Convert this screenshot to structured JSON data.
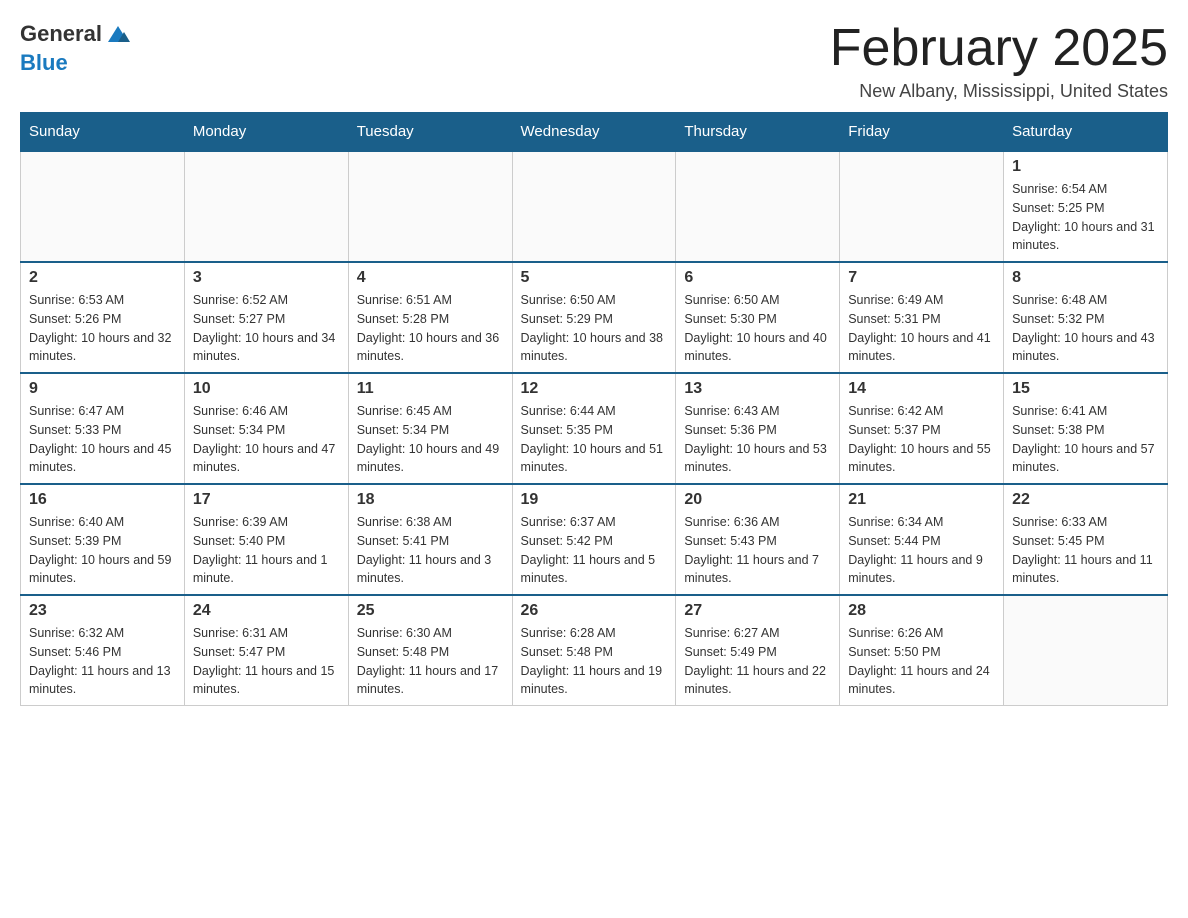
{
  "header": {
    "logo_general": "General",
    "logo_blue": "Blue",
    "month_title": "February 2025",
    "location": "New Albany, Mississippi, United States"
  },
  "weekdays": [
    "Sunday",
    "Monday",
    "Tuesday",
    "Wednesday",
    "Thursday",
    "Friday",
    "Saturday"
  ],
  "weeks": [
    [
      {
        "day": "",
        "info": ""
      },
      {
        "day": "",
        "info": ""
      },
      {
        "day": "",
        "info": ""
      },
      {
        "day": "",
        "info": ""
      },
      {
        "day": "",
        "info": ""
      },
      {
        "day": "",
        "info": ""
      },
      {
        "day": "1",
        "info": "Sunrise: 6:54 AM\nSunset: 5:25 PM\nDaylight: 10 hours and 31 minutes."
      }
    ],
    [
      {
        "day": "2",
        "info": "Sunrise: 6:53 AM\nSunset: 5:26 PM\nDaylight: 10 hours and 32 minutes."
      },
      {
        "day": "3",
        "info": "Sunrise: 6:52 AM\nSunset: 5:27 PM\nDaylight: 10 hours and 34 minutes."
      },
      {
        "day": "4",
        "info": "Sunrise: 6:51 AM\nSunset: 5:28 PM\nDaylight: 10 hours and 36 minutes."
      },
      {
        "day": "5",
        "info": "Sunrise: 6:50 AM\nSunset: 5:29 PM\nDaylight: 10 hours and 38 minutes."
      },
      {
        "day": "6",
        "info": "Sunrise: 6:50 AM\nSunset: 5:30 PM\nDaylight: 10 hours and 40 minutes."
      },
      {
        "day": "7",
        "info": "Sunrise: 6:49 AM\nSunset: 5:31 PM\nDaylight: 10 hours and 41 minutes."
      },
      {
        "day": "8",
        "info": "Sunrise: 6:48 AM\nSunset: 5:32 PM\nDaylight: 10 hours and 43 minutes."
      }
    ],
    [
      {
        "day": "9",
        "info": "Sunrise: 6:47 AM\nSunset: 5:33 PM\nDaylight: 10 hours and 45 minutes."
      },
      {
        "day": "10",
        "info": "Sunrise: 6:46 AM\nSunset: 5:34 PM\nDaylight: 10 hours and 47 minutes."
      },
      {
        "day": "11",
        "info": "Sunrise: 6:45 AM\nSunset: 5:34 PM\nDaylight: 10 hours and 49 minutes."
      },
      {
        "day": "12",
        "info": "Sunrise: 6:44 AM\nSunset: 5:35 PM\nDaylight: 10 hours and 51 minutes."
      },
      {
        "day": "13",
        "info": "Sunrise: 6:43 AM\nSunset: 5:36 PM\nDaylight: 10 hours and 53 minutes."
      },
      {
        "day": "14",
        "info": "Sunrise: 6:42 AM\nSunset: 5:37 PM\nDaylight: 10 hours and 55 minutes."
      },
      {
        "day": "15",
        "info": "Sunrise: 6:41 AM\nSunset: 5:38 PM\nDaylight: 10 hours and 57 minutes."
      }
    ],
    [
      {
        "day": "16",
        "info": "Sunrise: 6:40 AM\nSunset: 5:39 PM\nDaylight: 10 hours and 59 minutes."
      },
      {
        "day": "17",
        "info": "Sunrise: 6:39 AM\nSunset: 5:40 PM\nDaylight: 11 hours and 1 minute."
      },
      {
        "day": "18",
        "info": "Sunrise: 6:38 AM\nSunset: 5:41 PM\nDaylight: 11 hours and 3 minutes."
      },
      {
        "day": "19",
        "info": "Sunrise: 6:37 AM\nSunset: 5:42 PM\nDaylight: 11 hours and 5 minutes."
      },
      {
        "day": "20",
        "info": "Sunrise: 6:36 AM\nSunset: 5:43 PM\nDaylight: 11 hours and 7 minutes."
      },
      {
        "day": "21",
        "info": "Sunrise: 6:34 AM\nSunset: 5:44 PM\nDaylight: 11 hours and 9 minutes."
      },
      {
        "day": "22",
        "info": "Sunrise: 6:33 AM\nSunset: 5:45 PM\nDaylight: 11 hours and 11 minutes."
      }
    ],
    [
      {
        "day": "23",
        "info": "Sunrise: 6:32 AM\nSunset: 5:46 PM\nDaylight: 11 hours and 13 minutes."
      },
      {
        "day": "24",
        "info": "Sunrise: 6:31 AM\nSunset: 5:47 PM\nDaylight: 11 hours and 15 minutes."
      },
      {
        "day": "25",
        "info": "Sunrise: 6:30 AM\nSunset: 5:48 PM\nDaylight: 11 hours and 17 minutes."
      },
      {
        "day": "26",
        "info": "Sunrise: 6:28 AM\nSunset: 5:48 PM\nDaylight: 11 hours and 19 minutes."
      },
      {
        "day": "27",
        "info": "Sunrise: 6:27 AM\nSunset: 5:49 PM\nDaylight: 11 hours and 22 minutes."
      },
      {
        "day": "28",
        "info": "Sunrise: 6:26 AM\nSunset: 5:50 PM\nDaylight: 11 hours and 24 minutes."
      },
      {
        "day": "",
        "info": ""
      }
    ]
  ]
}
